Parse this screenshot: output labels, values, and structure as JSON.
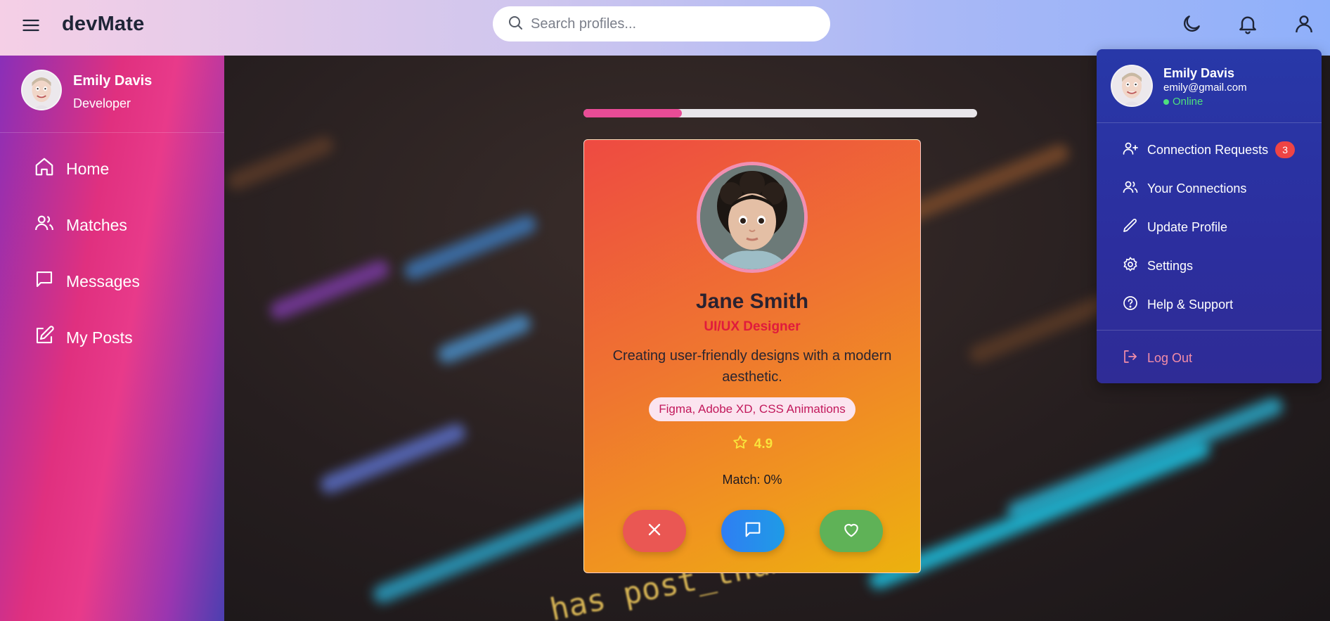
{
  "app": {
    "title": "devMate"
  },
  "search": {
    "placeholder": "Search profiles..."
  },
  "header": {
    "icons": [
      "menu-icon",
      "moon-icon",
      "bell-icon",
      "user-icon"
    ]
  },
  "user": {
    "name": "Emily Davis",
    "role": "Developer",
    "email": "emily@gmail.com",
    "status": "Online"
  },
  "sidebar": {
    "items": [
      {
        "label": "Home",
        "icon": "home-icon"
      },
      {
        "label": "Matches",
        "icon": "users-icon"
      },
      {
        "label": "Messages",
        "icon": "message-icon"
      },
      {
        "label": "My Posts",
        "icon": "edit-icon"
      }
    ]
  },
  "progress": {
    "fraction": 0.25
  },
  "profile_card": {
    "name": "Jane Smith",
    "role": "UI/UX Designer",
    "bio": "Creating user-friendly designs with a modern aesthetic.",
    "skills": "Figma, Adobe XD, CSS Animations",
    "rating": "4.9",
    "match": "Match: 0%",
    "actions": [
      "pass-button",
      "message-button",
      "like-button"
    ]
  },
  "dropdown": {
    "items": [
      {
        "label": "Connection Requests",
        "icon": "user-plus-icon",
        "badge": "3"
      },
      {
        "label": "Your Connections",
        "icon": "users-icon"
      },
      {
        "label": "Update Profile",
        "icon": "pencil-icon"
      },
      {
        "label": "Settings",
        "icon": "gear-icon"
      },
      {
        "label": "Help & Support",
        "icon": "help-icon"
      }
    ],
    "logout_label": "Log Out"
  },
  "colors": {
    "accent_pink": "#e84c96",
    "dropdown_bg": "#2838a8",
    "badge_red": "#ef4444",
    "online_green": "#4ee07d"
  }
}
